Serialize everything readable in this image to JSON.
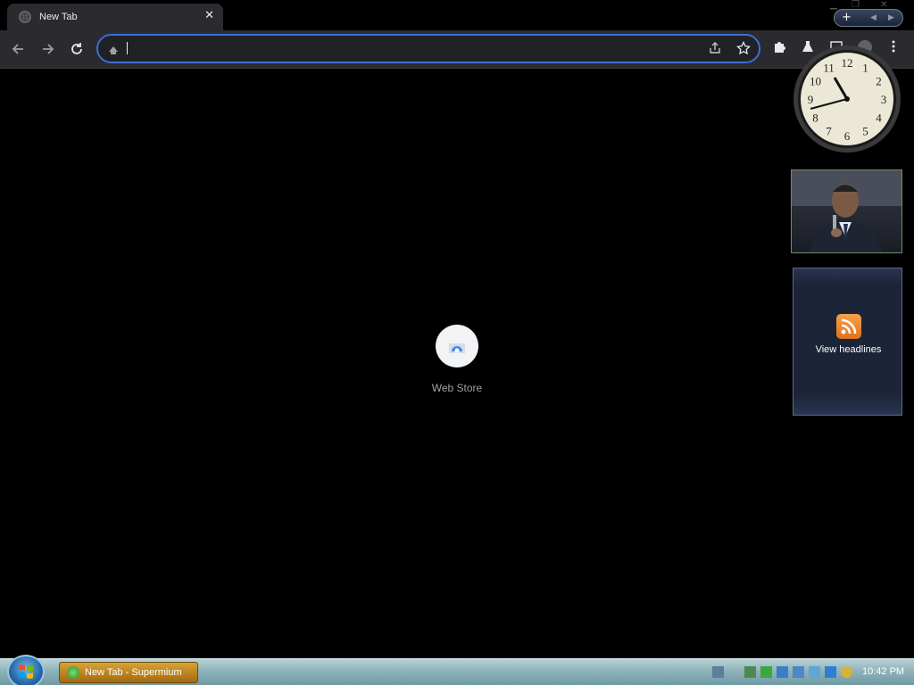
{
  "tab": {
    "title": "New Tab",
    "close": "✕"
  },
  "omnibox": {
    "value": "",
    "placeholder": ""
  },
  "shortcut": {
    "label": "Web Store"
  },
  "gadgets": {
    "clock_numbers": [
      "12",
      "1",
      "2",
      "3",
      "4",
      "5",
      "6",
      "7",
      "8",
      "9",
      "10",
      "11"
    ],
    "feed_label": "View headlines"
  },
  "taskbar": {
    "task_title": "New Tab - Supermium",
    "time": "10:42 PM"
  },
  "icons": {
    "back": "back-arrow-icon",
    "forward": "forward-arrow-icon",
    "reload": "reload-icon",
    "share": "share-icon",
    "star": "bookmark-star-icon",
    "extensions": "puzzle-icon",
    "labs": "flask-icon",
    "profile": "profile-icon",
    "menu": "kebab-menu-icon"
  },
  "colors": {
    "accent": "#3b6fd4",
    "toolbar": "#2b2b2f",
    "background": "#000000"
  }
}
